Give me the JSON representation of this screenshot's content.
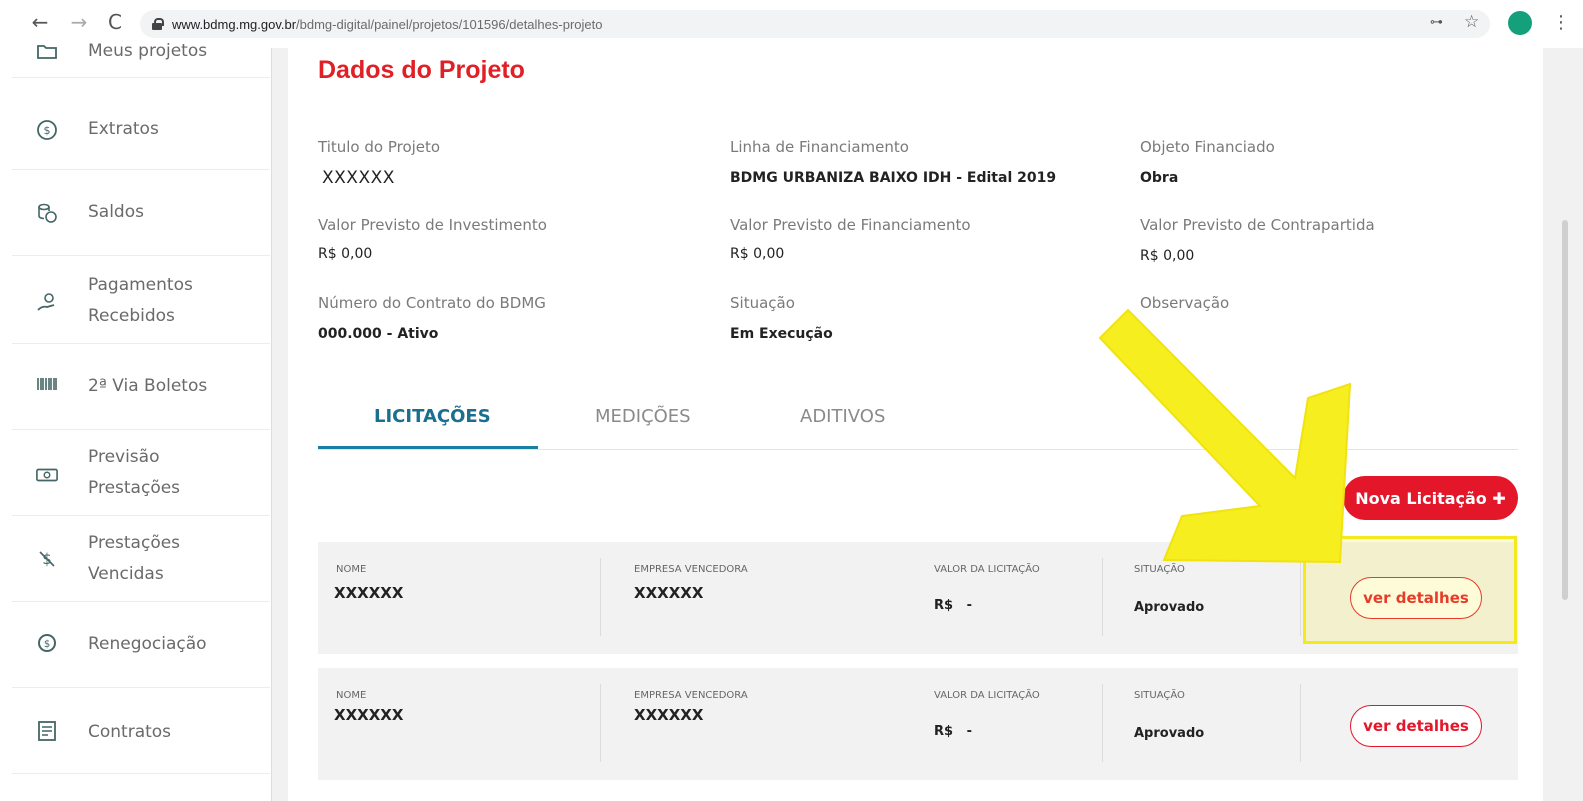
{
  "browser": {
    "back": "←",
    "forward": "→",
    "reload": "C",
    "url_host": "www.bdmg.mg.gov.br",
    "url_path": "/bdmg-digital/painel/projetos/101596/detalhes-projeto",
    "key": "⊶",
    "star": "☆",
    "menu": "⋮"
  },
  "sidebar": {
    "items": [
      {
        "label": "Meus projetos",
        "icon": "folder-icon"
      },
      {
        "label": "Extratos",
        "icon": "dollar-coin-icon"
      },
      {
        "label": "Saldos",
        "icon": "coins-icon"
      },
      {
        "label": "Pagamentos Recebidos",
        "icon": "hand-coin-icon"
      },
      {
        "label": "2ª Via Boletos",
        "icon": "barcode-icon"
      },
      {
        "label": "Previsão Prestações",
        "icon": "banknote-icon"
      },
      {
        "label": "Prestações Vencidas",
        "icon": "dollar-slash-icon"
      },
      {
        "label": "Renegociação",
        "icon": "coin-cycle-icon"
      },
      {
        "label": "Contratos",
        "icon": "document-icon"
      }
    ]
  },
  "project": {
    "title": "Dados do Projeto",
    "fields": {
      "titulo_label": "Titulo do Projeto",
      "titulo_value": "XXXXXX",
      "linha_label": "Linha de Financiamento",
      "linha_value": "BDMG URBANIZA BAIXO IDH - Edital 2019",
      "objeto_label": "Objeto Financiado",
      "objeto_value": "Obra",
      "inv_label": "Valor Previsto de Investimento",
      "inv_value": "R$ 0,00",
      "fin_label": "Valor Previsto de Financiamento",
      "fin_value": "R$ 0,00",
      "contra_label": "Valor Previsto de Contrapartida",
      "contra_value": "R$ 0,00",
      "contrato_label": "Número do Contrato do BDMG",
      "contrato_value": "000.000 - Ativo",
      "situacao_label": "Situação",
      "situacao_value": "Em Execução",
      "obs_label": "Observação"
    }
  },
  "tabs": [
    {
      "label": "LICITAÇÕES",
      "active": true
    },
    {
      "label": "MEDIÇÕES",
      "active": false
    },
    {
      "label": "ADITIVOS",
      "active": false
    }
  ],
  "new_button": "Nova Licitação ✚",
  "table": {
    "headers": {
      "nome": "NOME",
      "empresa": "EMPRESA VENCEDORA",
      "valor": "VALOR DA LICITAÇÃO",
      "situacao": "SITUAÇÃO"
    },
    "rows": [
      {
        "nome": "XXXXXX",
        "empresa": "XXXXXX",
        "valor": "R$   -",
        "situacao": "Aprovado",
        "action": "ver detalhes"
      },
      {
        "nome": "XXXXXX",
        "empresa": "XXXXXX",
        "valor": "R$   -",
        "situacao": "Aprovado",
        "action": "ver detalhes"
      }
    ]
  },
  "colors": {
    "brand_red": "#e01f26",
    "tab_blue": "#1a6f8f",
    "highlight_yellow": "#f4ea1b"
  }
}
